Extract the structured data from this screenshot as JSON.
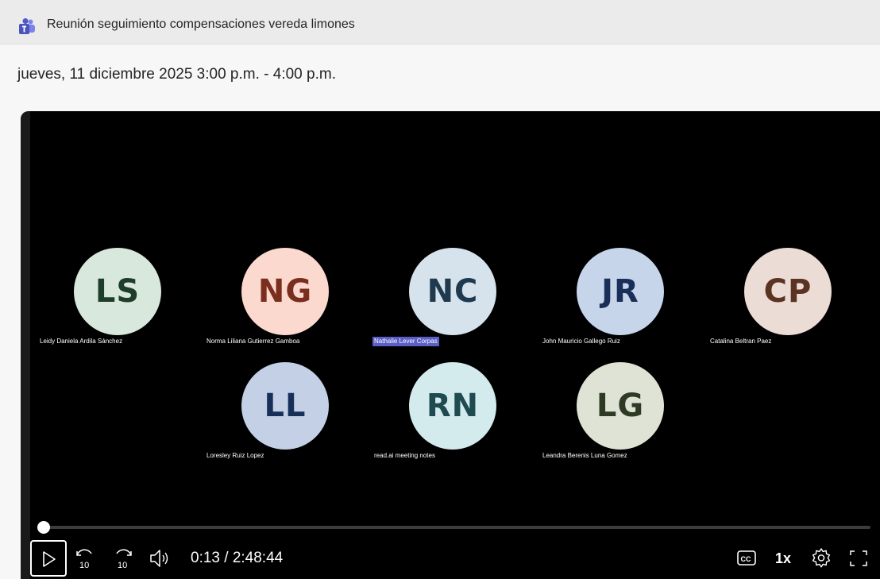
{
  "window": {
    "title": "Reunión seguimiento compensaciones vereda limones",
    "app_icon": "teams-icon"
  },
  "meeting": {
    "datetime": "jueves, 11 diciembre 2025 3:00 p.m. - 4:00 p.m."
  },
  "participants": [
    {
      "initials": "LS",
      "name": "Leidy Daniela Ardila Sánchez",
      "bg": "#d9e8dc",
      "fg": "#1f3d2b",
      "highlighted": false
    },
    {
      "initials": "NG",
      "name": "Norma Liliana Gutierrez Gamboa",
      "bg": "#fcd9cf",
      "fg": "#7a2e1e",
      "highlighted": false
    },
    {
      "initials": "NC",
      "name": "Nathalie Lever Corpas",
      "bg": "#d6e3ec",
      "fg": "#1f3a4f",
      "highlighted": true
    },
    {
      "initials": "JR",
      "name": "John Mauricio Gallego Ruiz",
      "bg": "#c7d5ea",
      "fg": "#1a2e5a",
      "highlighted": false
    },
    {
      "initials": "CP",
      "name": "Catalina Beltran Paez",
      "bg": "#ecdcd6",
      "fg": "#5a3323",
      "highlighted": false
    },
    {
      "initials": "LL",
      "name": "Loresley Ruiz Lopez",
      "bg": "#c3d0e6",
      "fg": "#17305a",
      "highlighted": false
    },
    {
      "initials": "RN",
      "name": "read.ai meeting notes",
      "bg": "#d3ebed",
      "fg": "#1f4a50",
      "highlighted": false
    },
    {
      "initials": "LG",
      "name": "Leandra Berenis Luna Gomez",
      "bg": "#dfe3d6",
      "fg": "#2e3a24",
      "highlighted": false
    }
  ],
  "player": {
    "progress_fraction": 0.0013,
    "time_display": "0:13 / 2:48:44",
    "speed": "1x",
    "controls": {
      "play": "play-icon",
      "rewind": "rewind-10-icon",
      "forward": "forward-10-icon",
      "volume": "volume-icon",
      "captions": "closed-captions-icon",
      "settings": "gear-icon",
      "fullscreen": "fullscreen-icon"
    },
    "rewind_label": "10",
    "forward_label": "10",
    "cc_label": "CC"
  }
}
